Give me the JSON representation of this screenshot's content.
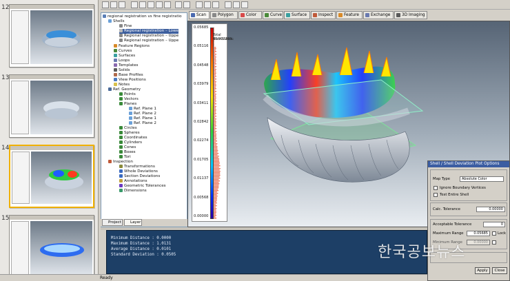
{
  "slides": [
    {
      "number": "12",
      "selected": false
    },
    {
      "number": "13",
      "selected": false
    },
    {
      "number": "14",
      "selected": true
    },
    {
      "number": "15",
      "selected": false
    }
  ],
  "tree": {
    "root": "regional registration vs fine registratio",
    "items": [
      "Shells",
      "Fine",
      "Regional registration – Lowe",
      "Regional registration – Uppe",
      "Regional registration – Uppe",
      "Feature Regions",
      "Curves",
      "Surfaces",
      "Loops",
      "Templates",
      "Solids",
      "Base Profiles",
      "View Positions",
      "Notes",
      "Ref. Geometry",
      "Points",
      "Vectors",
      "Planes",
      "Ref. Plane 1",
      "Ref. Plane 2",
      "Ref. Plane 1",
      "Ref. Plane 2",
      "Circles",
      "Spheres",
      "Coordinates",
      "Cylinders",
      "Cones",
      "Boxes",
      "Tori",
      "Inspection",
      "Transformations",
      "Whole Deviations",
      "Section Deviations",
      "Annotations",
      "Geometric Tolerances",
      "Dimensions"
    ],
    "tabs": [
      "Project",
      "Layer"
    ]
  },
  "view_tabs": [
    "Scan",
    "Polygon",
    "Color",
    "Curve",
    "Surface",
    "Inspect",
    "Feature",
    "Exchange",
    "3D Imaging"
  ],
  "legend": {
    "values": [
      "0.05685",
      "0.05116",
      "0.04548",
      "0.03979",
      "0.03411",
      "0.02842",
      "0.02274",
      "0.01705",
      "0.01137",
      "0.00568",
      "0.00000"
    ],
    "label_top": "Total distribution:",
    "label_value": "66.97726%"
  },
  "log": {
    "lines": [
      "Minimum Distance : 0.0000",
      "Maximum Distance : 1.0131",
      "Average Distance : 0.0101",
      "Standard Deviation : 0.0505"
    ]
  },
  "status": "Ready",
  "options": {
    "title": "Shell / Shell Deviation Plot Options",
    "map_type_label": "Map Type",
    "map_type_value": "Absolute Color",
    "ignore_boundary": "Ignore Boundary Vertices",
    "test_entire": "Test Entire Shell",
    "calc_tol_label": "Calc. Tolerance",
    "calc_tol_value": "0.00000",
    "accept_tol_label": "Acceptable Tolerance",
    "accept_tol_value": "0",
    "max_range_label": "Maximum Range",
    "max_range_value": "0.05685",
    "lock_label": "Lock",
    "min_range_label": "Minimum Range",
    "min_range_value": "0.00000",
    "apply": "Apply",
    "close": "Close"
  },
  "watermark": "한국공보뉴스"
}
